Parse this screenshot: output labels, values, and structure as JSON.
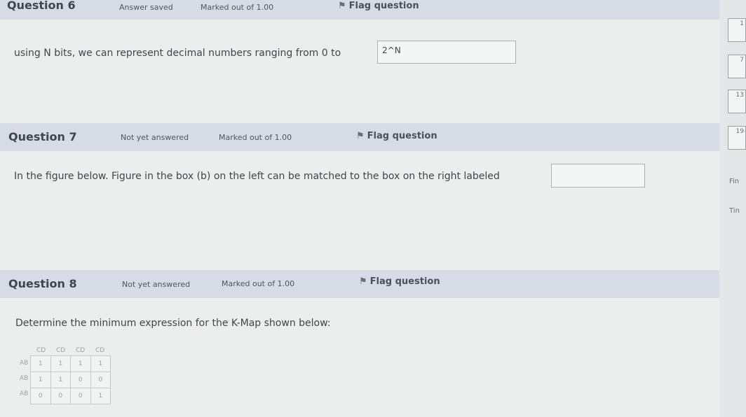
{
  "q6": {
    "number": "Question 6",
    "status": "Answer saved",
    "marked": "Marked out of 1.00",
    "flag": "Flag question",
    "text": "using N bits, we can represent decimal numbers ranging from 0 to",
    "answer": "2^N"
  },
  "q7": {
    "number": "Question 7",
    "status": "Not yet answered",
    "marked": "Marked out of 1.00",
    "flag": "Flag question",
    "text": "In the figure below.  Figure in the box (b) on the left can be matched to the box on the right labeled",
    "answer": ""
  },
  "q8": {
    "number": "Question 8",
    "status": "Not yet answered",
    "marked": "Marked out of 1.00",
    "flag": "Flag question",
    "text": "Determine the minimum expression for the K-Map shown below:",
    "kmap": {
      "col_headers": [
        "CD",
        "CD",
        "CD",
        "CD"
      ],
      "row_headers": [
        "AB",
        "AB",
        "AB"
      ],
      "rows": [
        [
          "1",
          "1",
          "1",
          "1"
        ],
        [
          "1",
          "1",
          "0",
          "0"
        ],
        [
          "0",
          "0",
          "0",
          "1"
        ]
      ]
    }
  },
  "nav": {
    "boxes": [
      "1",
      "7",
      "13",
      "19"
    ],
    "labels": [
      "Fin",
      "Tin"
    ]
  }
}
